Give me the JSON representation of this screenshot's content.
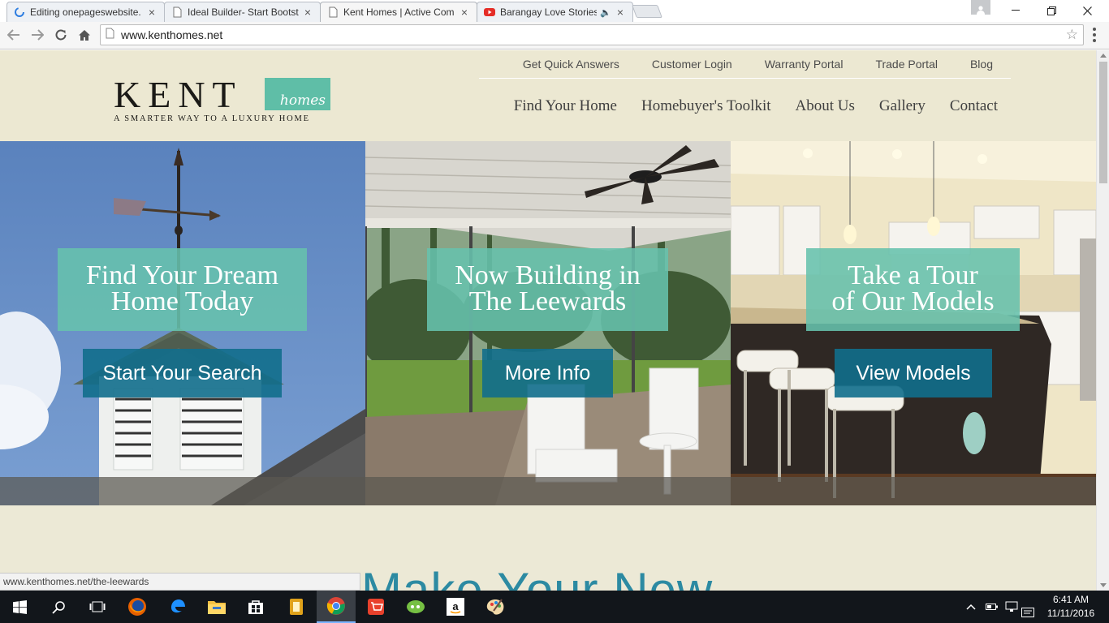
{
  "browser": {
    "tabs": [
      {
        "title": "Editing onepageswebsite.",
        "icon": "loading-spinner-icon"
      },
      {
        "title": "Ideal Builder- Start Bootst",
        "icon": "page-icon"
      },
      {
        "title": "Kent Homes | Active Com",
        "icon": "page-icon",
        "active": true
      },
      {
        "title": "Barangay Love Stories",
        "icon": "youtube-icon",
        "audio": true
      }
    ],
    "url": "www.kenthomes.net",
    "window_controls": [
      "minimize",
      "restore",
      "close"
    ]
  },
  "site": {
    "logo": {
      "name": "KENT",
      "badge": "homes",
      "tagline": "A SMARTER WAY TO A LUXURY HOME"
    },
    "utility_nav": [
      "Get Quick Answers",
      "Customer Login",
      "Warranty Portal",
      "Trade Portal",
      "Blog"
    ],
    "main_nav": [
      "Find Your Home",
      "Homebuyer's Toolkit",
      "About Us",
      "Gallery",
      "Contact"
    ],
    "panels": [
      {
        "caption_line1": "Find Your Dream",
        "caption_line2": "Home Today",
        "button": "Start Your Search"
      },
      {
        "caption_line1": "Now Building in",
        "caption_line2": "The Leewards",
        "button": "More Info"
      },
      {
        "caption_line1": "Take a Tour",
        "caption_line2": "of Our Models",
        "button": "View Models"
      }
    ],
    "section_heading": "Make Your New"
  },
  "status_bar": "www.kenthomes.net/the-leewards",
  "taskbar": {
    "apps": [
      "start-icon",
      "search-icon",
      "task-view-icon",
      "firefox-icon",
      "edge-icon",
      "file-explorer-icon",
      "store-icon",
      "app-icon",
      "chrome-icon",
      "shopping-icon",
      "chat-icon",
      "amazon-icon",
      "paint-icon"
    ],
    "time": "6:41 AM",
    "date": "11/11/2016"
  },
  "colors": {
    "teal": "#67c2ad",
    "blue_button": "#116e8c",
    "header_bg": "#ece8d2"
  }
}
